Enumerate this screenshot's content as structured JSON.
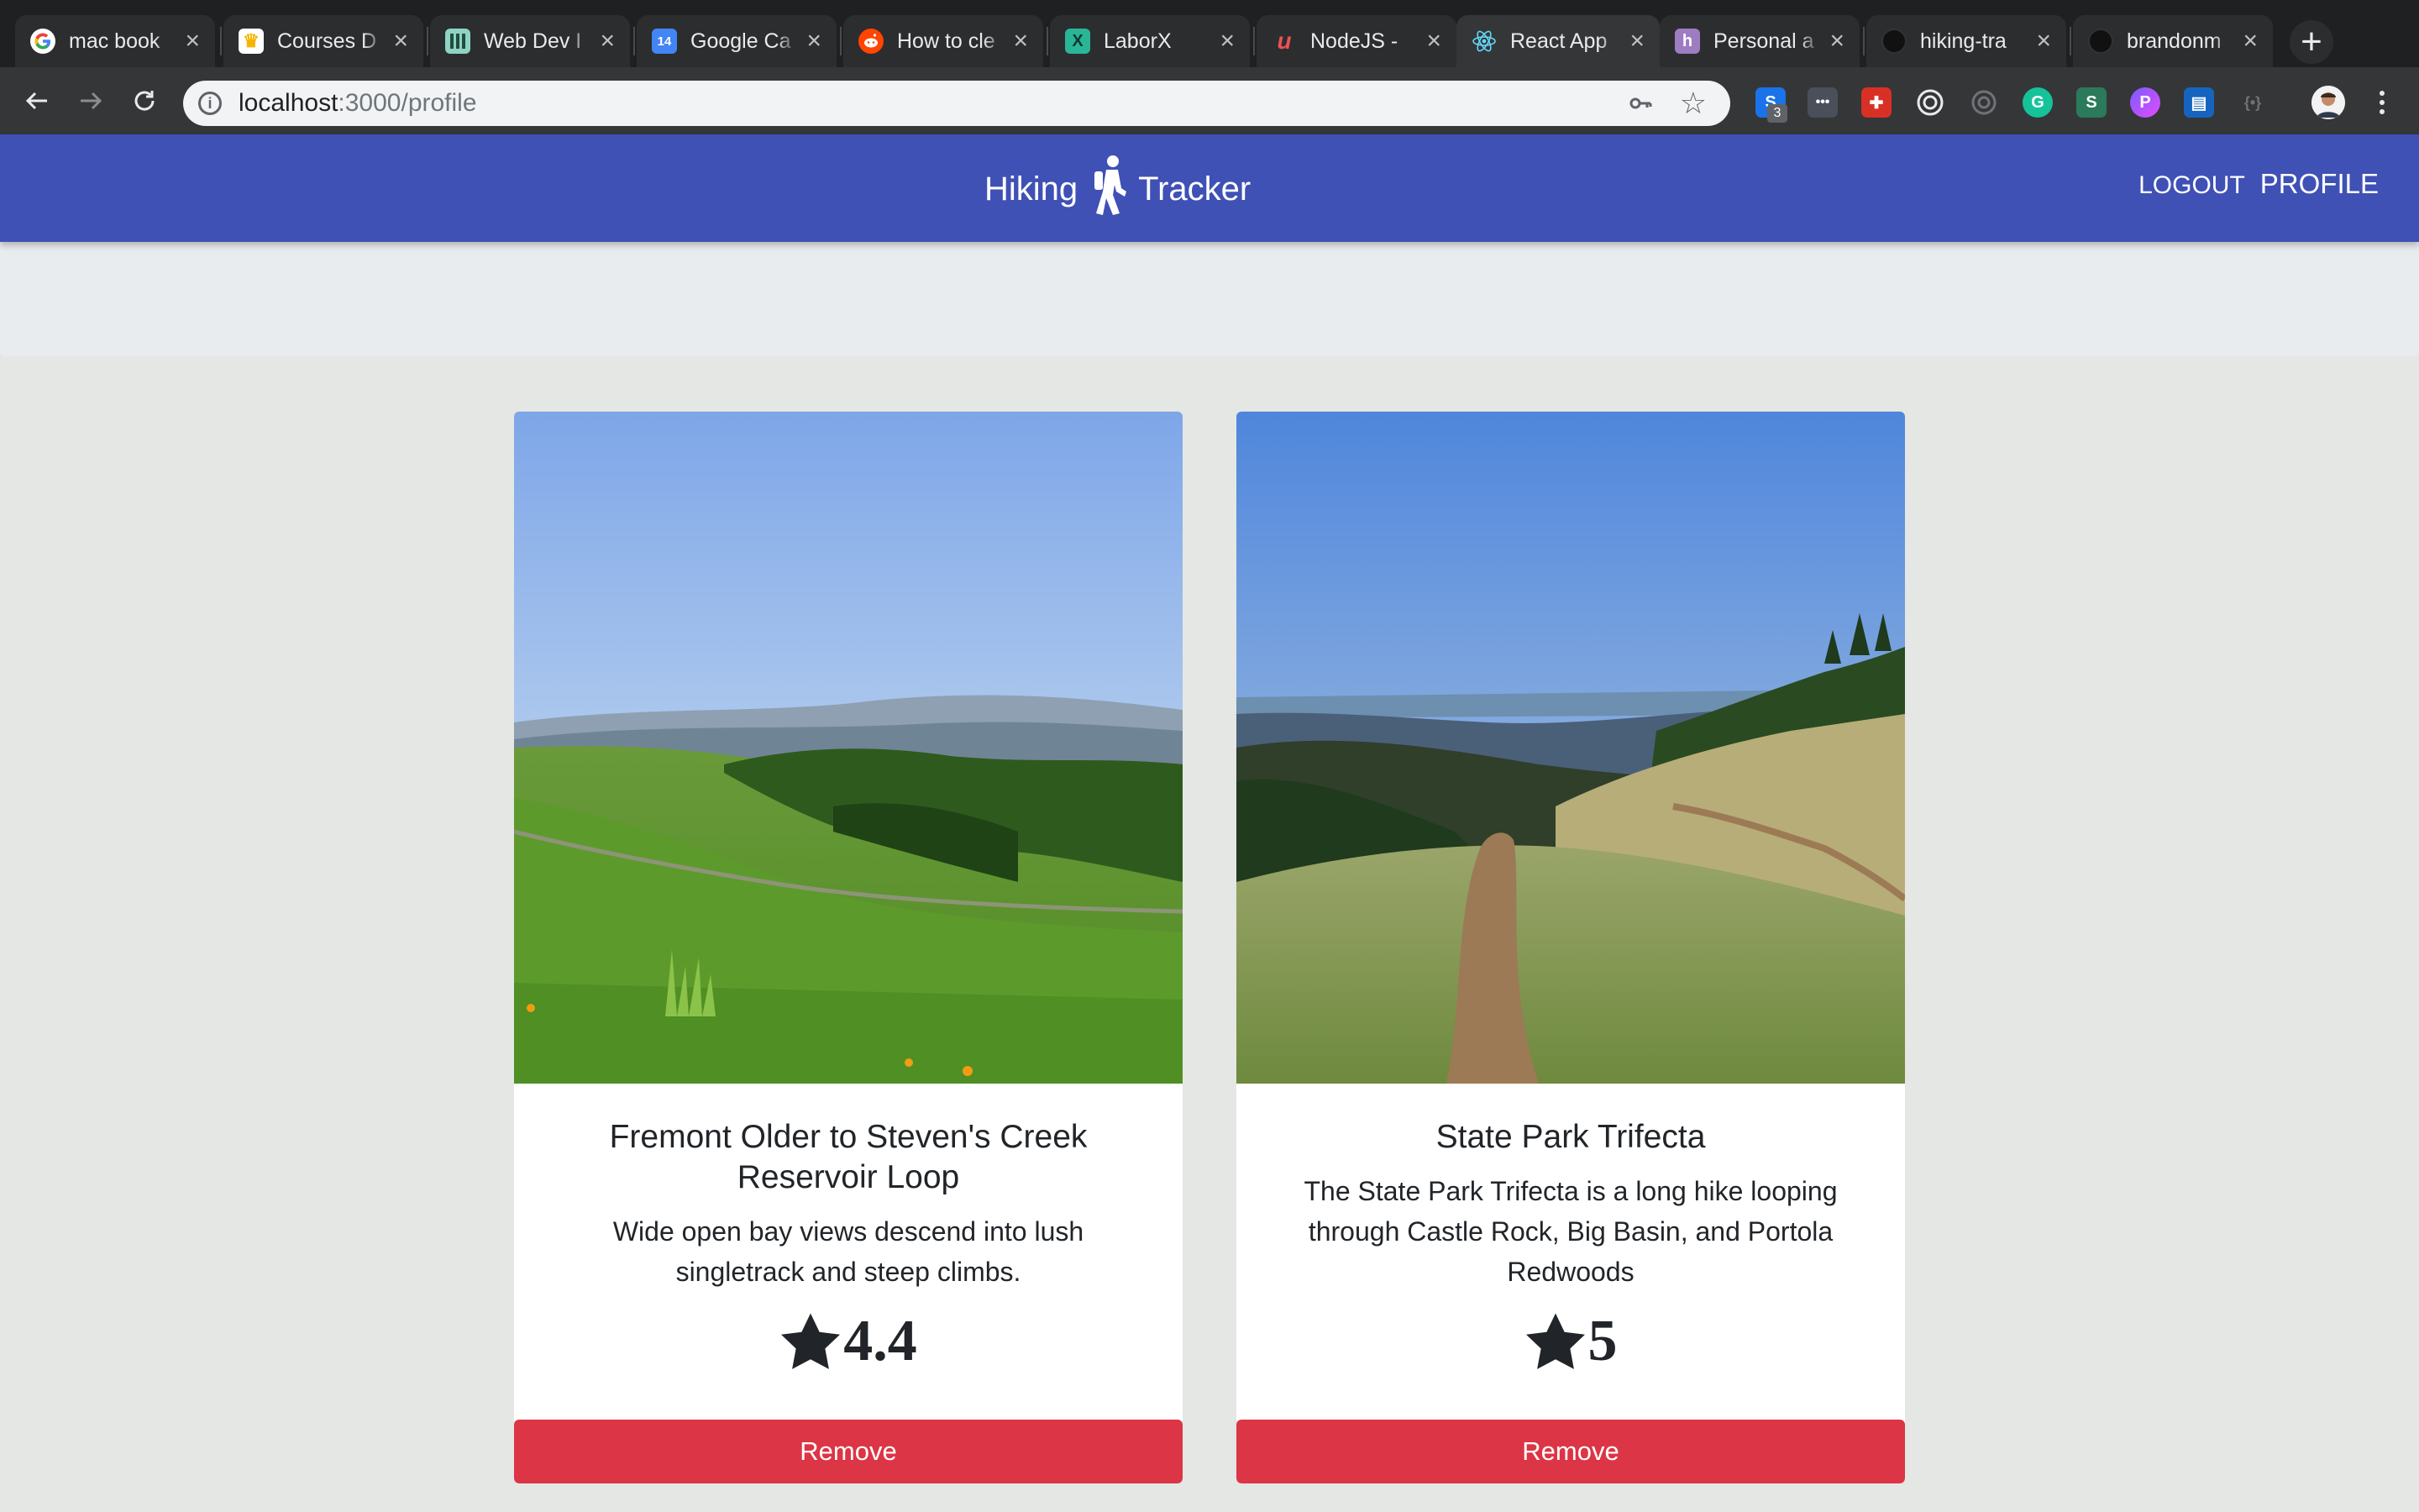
{
  "browser": {
    "tabs": [
      {
        "title": "mac book",
        "icon": "google-icon",
        "active": false
      },
      {
        "title": "Courses D",
        "icon": "crown-icon",
        "active": false
      },
      {
        "title": "Web Dev I",
        "icon": "grid-icon",
        "active": false
      },
      {
        "title": "Google Ca",
        "icon": "calendar-icon",
        "active": false
      },
      {
        "title": "How to cle",
        "icon": "reddit-icon",
        "active": false
      },
      {
        "title": "LaborX",
        "icon": "laborx-icon",
        "active": false
      },
      {
        "title": "NodeJS -",
        "icon": "udemy-icon",
        "active": false
      },
      {
        "title": "React App",
        "icon": "react-icon",
        "active": true
      },
      {
        "title": "Personal a",
        "icon": "heroku-icon",
        "active": false
      },
      {
        "title": "hiking-tra",
        "icon": "github-icon",
        "active": false
      },
      {
        "title": "brandonm",
        "icon": "github-icon",
        "active": false
      }
    ],
    "calendar_day": "14",
    "address": {
      "host": "localhost",
      "path": ":3000/profile"
    },
    "extension_badge": "3"
  },
  "navbar": {
    "brand_left": "Hiking",
    "brand_right": "Tracker",
    "links": {
      "logout": "LOGOUT",
      "profile": "PROFILE"
    },
    "color": "#3f51b5"
  },
  "hikes": [
    {
      "title": "Fremont Older to Steven's Creek Reservoir Loop",
      "description": "Wide open bay views descend into lush singletrack and steep climbs.",
      "rating": "4.4",
      "remove_label": "Remove"
    },
    {
      "title": "State Park Trifecta",
      "description": "The State Park Trifecta is a long hike looping through Castle Rock, Big Basin, and Portola Redwoods",
      "rating": "5",
      "remove_label": "Remove"
    }
  ],
  "colors": {
    "remove_button": "#dc3545",
    "page_background": "#e4e7e3"
  }
}
